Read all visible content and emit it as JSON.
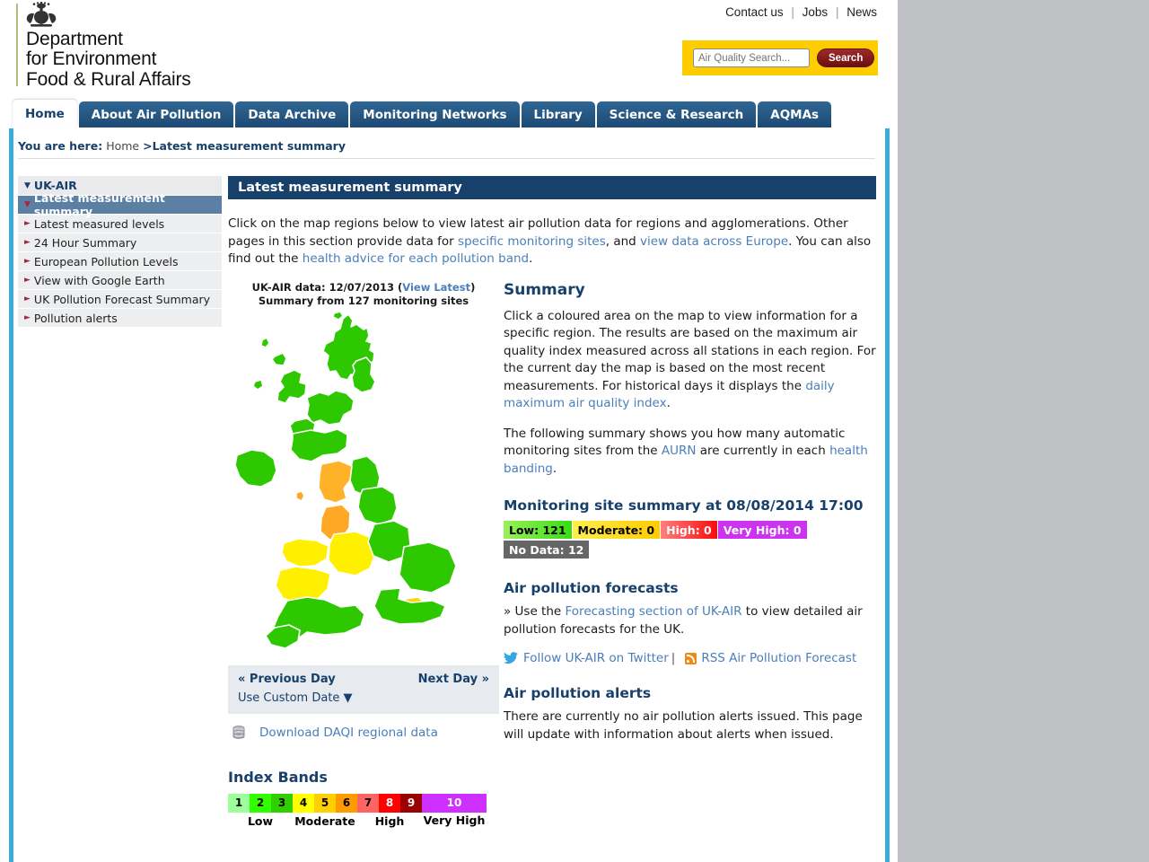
{
  "header": {
    "dept_line1": "Department",
    "dept_line2": "for Environment",
    "dept_line3": "Food & Rural Affairs",
    "toplinks": [
      "Contact us",
      "Jobs",
      "News"
    ],
    "search_placeholder": "Air Quality Search...",
    "search_button": "Search"
  },
  "nav": {
    "tabs": [
      {
        "label": "Home",
        "active": true
      },
      {
        "label": "About Air Pollution",
        "active": false
      },
      {
        "label": "Data Archive",
        "active": false
      },
      {
        "label": "Monitoring Networks",
        "active": false
      },
      {
        "label": "Library",
        "active": false
      },
      {
        "label": "Science & Research",
        "active": false
      },
      {
        "label": "AQMAs",
        "active": false
      }
    ]
  },
  "breadcrumb": {
    "prefix": "You are here:",
    "home": "Home",
    "separator": ">",
    "current": "Latest measurement summary"
  },
  "sidebar": {
    "root": "UK-AIR",
    "selected": "Latest measurement summary",
    "items": [
      {
        "label": "Latest measured levels"
      },
      {
        "label": "24 Hour Summary"
      },
      {
        "label": "European Pollution Levels"
      },
      {
        "label": "View with Google Earth"
      },
      {
        "label": "UK Pollution Forecast Summary"
      },
      {
        "label": "Pollution alerts"
      }
    ]
  },
  "main": {
    "banner": "Latest measurement summary",
    "intro_1": "Click on the map regions below to view latest air pollution data for regions and agglomerations. Other pages in this section provide data for ",
    "intro_link_1": "specific monitoring sites",
    "intro_2": ", and ",
    "intro_link_2": "view data across Europe",
    "intro_3": ". You can also find out the ",
    "intro_link_3": "health advice for each pollution band",
    "intro_4": "."
  },
  "map": {
    "caption_prefix": "UK-AIR data: 12/07/2013 (",
    "caption_link": "View Latest",
    "caption_suffix": ")",
    "caption_line2": "Summary from 127 monitoring sites",
    "previous_day": "« Previous Day",
    "next_day": "Next Day »",
    "custom_date": "Use Custom Date ▼",
    "download_label": "Download DAQI regional data"
  },
  "index_bands": {
    "title": "Index Bands",
    "bands": [
      {
        "value": "1",
        "color": "#9cff9c"
      },
      {
        "value": "2",
        "color": "#31ff00"
      },
      {
        "value": "3",
        "color": "#31cf00"
      },
      {
        "value": "4",
        "color": "#ffff00"
      },
      {
        "value": "5",
        "color": "#ffcf00"
      },
      {
        "value": "6",
        "color": "#ff9a00"
      },
      {
        "value": "7",
        "color": "#ff6464"
      },
      {
        "value": "8",
        "color": "#ff0000"
      },
      {
        "value": "9",
        "color": "#990000"
      },
      {
        "value": "10",
        "color": "#ce30ff"
      }
    ],
    "labels": [
      "Low",
      "Moderate",
      "High",
      "Very High"
    ]
  },
  "summary": {
    "title": "Summary",
    "p1_a": "Click a coloured area on the map to view information for a specific region. The results are based on the maximum air quality index measured across all stations in each region. For the current day the map is based on the most recent measurements. For historical days it displays the ",
    "p1_link": "daily maximum air quality index",
    "p1_b": ".",
    "p2_a": "The following summary shows you how many automatic monitoring sites from the ",
    "p2_link1": "AURN",
    "p2_b": " are currently in each ",
    "p2_link2": "health banding",
    "p2_c": ".",
    "site_summary_title": "Monitoring site summary at 08/08/2014 17:00",
    "badges": [
      {
        "label": "Low: 121",
        "bg": "#55e618",
        "fg": "#000000"
      },
      {
        "label": "Moderate: 0",
        "bg": "#ffd400",
        "fg": "#000000"
      },
      {
        "label": "High: 0",
        "bg": "#fa2020",
        "fg": "#ffffff"
      },
      {
        "label": "Very High: 0",
        "bg": "#cc33ee",
        "fg": "#ffffff"
      },
      {
        "label": "No Data: 12",
        "bg": "#666666",
        "fg": "#ffffff"
      }
    ]
  },
  "forecasts": {
    "title": "Air pollution forecasts",
    "text_a": "» Use the ",
    "link": "Forecasting section of UK-AIR",
    "text_b": " to view detailed air pollution forecasts for the UK.",
    "twitter_link": "Follow UK-AIR on Twitter",
    "divider": "|",
    "rss_link": "RSS Air Pollution Forecast"
  },
  "alerts": {
    "title": "Air pollution alerts",
    "text": "There are currently no air pollution alerts issued. This page will update with information about alerts when issued."
  }
}
